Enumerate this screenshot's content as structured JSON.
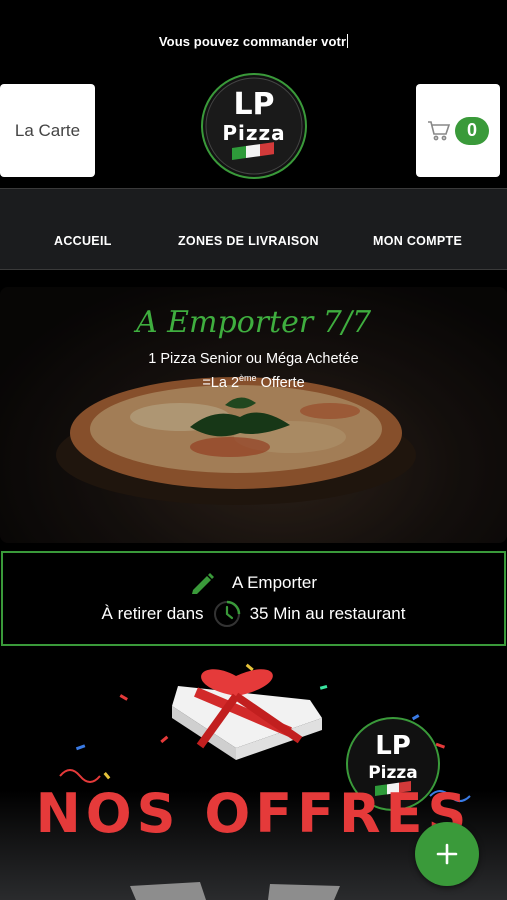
{
  "ticker": {
    "text": "Vous pouvez commander votr"
  },
  "header": {
    "menu_label": "La Carte",
    "cart_count": "0",
    "logo_text_top": "LP",
    "logo_text_bottom": "Pizza"
  },
  "nav": {
    "items": [
      {
        "label": "ACCUEIL"
      },
      {
        "label": "ZONES DE LIVRAISON"
      },
      {
        "label": "MON COMPTE"
      }
    ]
  },
  "banner": {
    "title": "A Emporter 7/7",
    "line1": "1 Pizza Senior ou Méga Achetée",
    "line2_prefix": "=La 2",
    "line2_sup": "ème",
    "line2_suffix": " Offerte"
  },
  "takeaway": {
    "mode": "A Emporter",
    "pickup_prefix": "À retirer dans",
    "pickup_suffix": "35 Min au restaurant"
  },
  "offers": {
    "title": "NOS OFFRES",
    "logo_text_top": "LP",
    "logo_text_bottom": "Pizza"
  },
  "colors": {
    "accent_green": "#3a9a3a",
    "offer_red": "#e53a3a",
    "nav_bg": "#1b1c1e"
  },
  "icons": [
    "cart-icon",
    "pencil-icon",
    "clock-icon",
    "plus-icon",
    "italian-flag-icon"
  ]
}
